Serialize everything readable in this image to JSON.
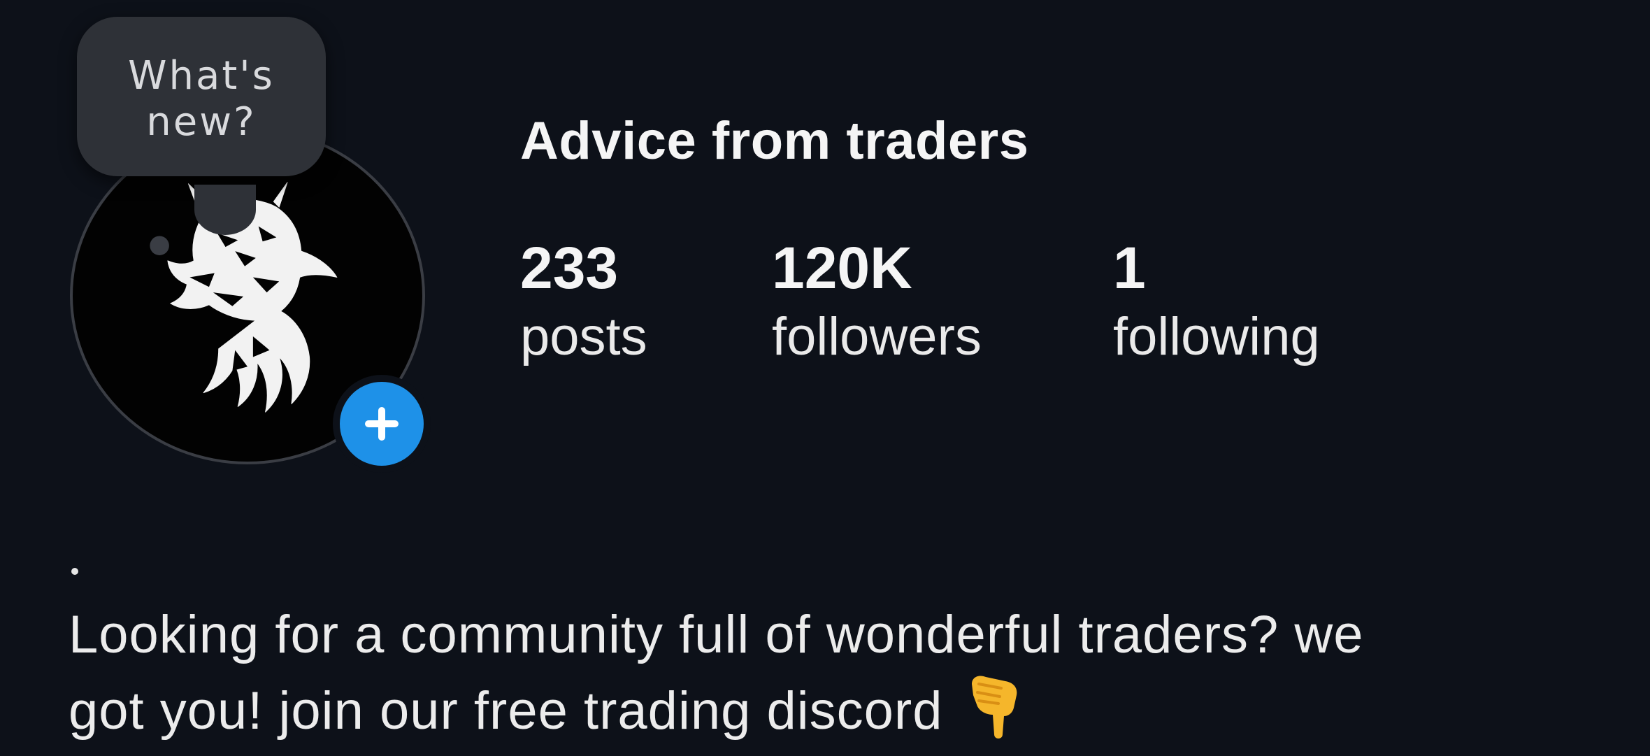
{
  "profile": {
    "name": "Advice from traders",
    "note": "What's\nnew?",
    "avatar_icon": "dragon-head-icon",
    "add_story_icon": "plus-icon",
    "accent_color": "#1e91e8",
    "background_color": "#0d1119"
  },
  "stats": {
    "posts": {
      "value": "233",
      "label": "posts"
    },
    "followers": {
      "value": "120K",
      "label": "followers"
    },
    "following": {
      "value": "1",
      "label": "following"
    }
  },
  "bio": {
    "dot": ".",
    "line1": "Looking for a community full of wonderful traders? we",
    "line2": "got you! join our free trading discord",
    "emoji_icon": "pointing-down-icon"
  }
}
